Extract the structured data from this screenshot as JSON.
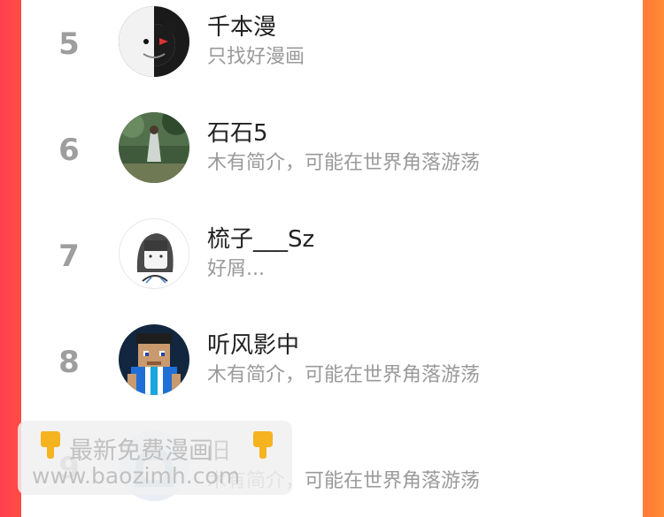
{
  "ranking": {
    "items": [
      {
        "rank": "5",
        "name": "千本漫",
        "desc": "只找好漫画",
        "avatar": "monokuma-avatar"
      },
      {
        "rank": "6",
        "name": "石石5",
        "desc": "木有简介，可能在世界角落游荡",
        "avatar": "girl-in-forest-avatar"
      },
      {
        "rank": "7",
        "name": "梳子___Sz",
        "desc": "好屑...",
        "avatar": "sketch-girl-avatar"
      },
      {
        "rank": "8",
        "name": "听风影中",
        "desc": "木有简介，可能在世界角落游荡",
        "avatar": "pixel-character-avatar"
      },
      {
        "rank": "9",
        "name": "旧",
        "desc": "木有简介，可能在世界角落游荡",
        "avatar": "anime-avatar"
      }
    ]
  },
  "watermark": {
    "line1": "最新免费漫画",
    "line2": "www.baozimh.com"
  },
  "colors": {
    "background_left": "#ff3f4f",
    "background_right": "#ff8a33",
    "rank_color": "#9e9e9e",
    "name_color": "#222222",
    "desc_color": "#9a9a9a"
  }
}
